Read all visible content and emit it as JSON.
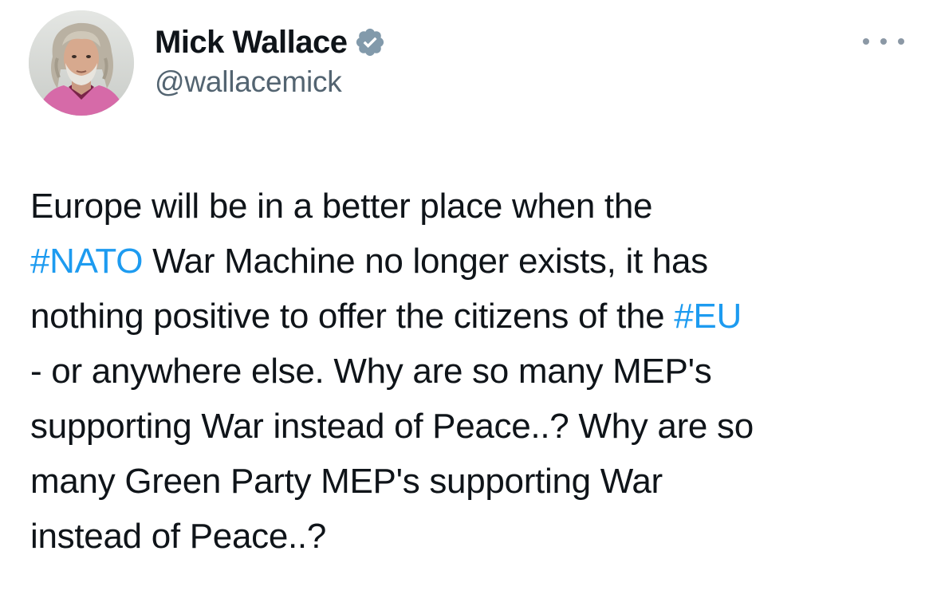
{
  "user": {
    "display_name": "Mick Wallace",
    "handle": "@wallacemick",
    "verified": true,
    "verified_icon": "verified-badge-icon",
    "avatar_icon": "profile-photo"
  },
  "more_icon": "more-options-icon",
  "tweet": {
    "lines": [
      [
        {
          "text": "Europe will be in a better place when the",
          "type": "text"
        }
      ],
      [
        {
          "text": "#NATO",
          "type": "hashtag"
        },
        {
          "text": " War Machine no longer exists, it has",
          "type": "text"
        }
      ],
      [
        {
          "text": "nothing positive to offer the citizens of the ",
          "type": "text"
        },
        {
          "text": "#EU",
          "type": "hashtag"
        }
      ],
      [
        {
          "text": "- or anywhere else. Why are so many MEP's",
          "type": "text"
        }
      ],
      [
        {
          "text": "supporting War instead of Peace..? Why are so",
          "type": "text"
        }
      ],
      [
        {
          "text": "many Green Party MEP's supporting War",
          "type": "text"
        }
      ],
      [
        {
          "text": "instead of Peace..?",
          "type": "text"
        }
      ]
    ]
  },
  "colors": {
    "text": "#0f1419",
    "secondary": "#536471",
    "link": "#1d9bf0",
    "verified": "#829aab"
  }
}
